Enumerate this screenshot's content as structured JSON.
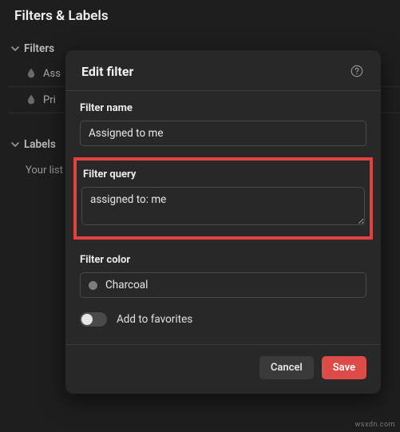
{
  "pageTitle": "Filters & Labels",
  "sections": {
    "filters": {
      "label": "Filters",
      "items": [
        {
          "label": "Ass"
        },
        {
          "label": "Pri"
        }
      ]
    },
    "labels": {
      "label": "Labels",
      "emptyText": "Your list"
    }
  },
  "modal": {
    "title": "Edit filter",
    "fields": {
      "name": {
        "label": "Filter name",
        "value": "Assigned to me"
      },
      "query": {
        "label": "Filter query",
        "value": "assigned to: me"
      },
      "color": {
        "label": "Filter color",
        "value": "Charcoal",
        "hex": "#7d7d7d"
      },
      "favorites": {
        "label": "Add to favorites",
        "value": false
      }
    },
    "buttons": {
      "cancel": "Cancel",
      "save": "Save"
    }
  },
  "watermark": "wsxdn.com"
}
